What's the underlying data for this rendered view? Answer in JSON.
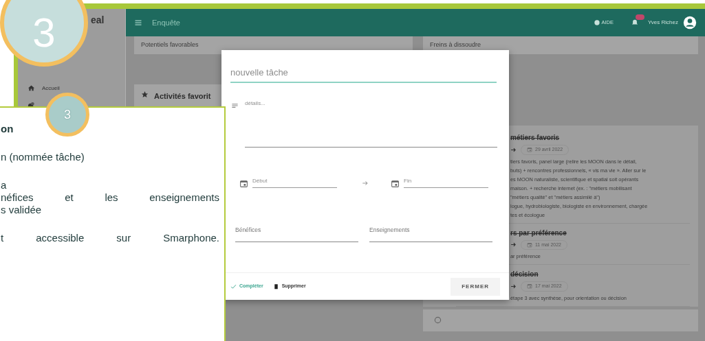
{
  "tutorial": {
    "large_step": "3",
    "small_step": "3",
    "callout": {
      "title": "on",
      "paragraphs": [
        [
          {
            "text": "n (nommée tâche)",
            "justified": false
          }
        ],
        [
          {
            "text": "a"
          },
          {
            "text": "néfices et les enseignements",
            "justified": true
          },
          {
            "text": "s validée",
            "justified": false
          }
        ],
        [
          {
            "text": "t accessible sur Smarphone.",
            "justified": true
          }
        ]
      ]
    }
  },
  "sidebar": {
    "brand": "eal",
    "items": [
      {
        "label": "Accueil",
        "kind": "home"
      },
      {
        "kind": "globe"
      }
    ]
  },
  "header": {
    "title": "Enquête",
    "help": "AIDE",
    "user": "Yves Richez"
  },
  "cards": {
    "top": [
      "Potentiels favorables",
      "Freins à dissoudre"
    ],
    "activities_title": "Activités favorit"
  },
  "tasks": [
    {
      "title": "métiers favoris",
      "done": true,
      "date": "29 avril 2022",
      "description": [
        "tiers favoris, panel large (relire les MOON dans le détail,",
        "buts) + rencontres professionnels, « vis ma vie ». Aller sur le",
        "es MOON naturaliste, scientifique et spatial soit opérants",
        "maison. + recherche internet (ex. : \"métiers mobilisant",
        "\"métiers qualité\" et \"métiers assimilé à\")",
        "logue, hydrobiologiste, biologiste en environnement, chargée",
        "tes et écologue"
      ]
    },
    {
      "title": "rs par préférence",
      "done": true,
      "date": "11 mai 2022",
      "description": [
        "ar préférence"
      ]
    },
    {
      "title": "décision",
      "done": true,
      "date": "17 mai 2022",
      "description": [
        "étape 3 avec synthèse, pour orientation ou décision"
      ]
    }
  ],
  "dialog": {
    "title_placeholder": "nouvelle tâche",
    "details_placeholder": "détails...",
    "start_placeholder": "Début",
    "end_placeholder": "Fin",
    "benefits_label": "Bénéfices",
    "lessons_label": "Enseignements",
    "complete": "Compléter",
    "delete": "Supprimer",
    "close": "FERMER"
  }
}
